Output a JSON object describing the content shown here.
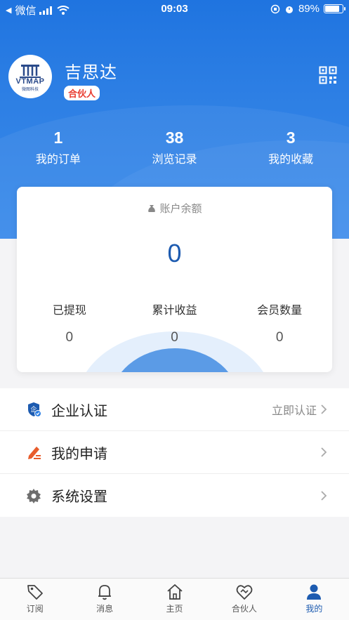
{
  "status_bar": {
    "back_app": "微信",
    "time": "09:03",
    "battery_percent": "89%",
    "battery_level": 0.89
  },
  "profile": {
    "avatar_logo": "VTMAP",
    "avatar_logo_sub": "微图科技",
    "username": "吉思达",
    "role_badge": "合伙人"
  },
  "stats": [
    {
      "value": "1",
      "label": "我的订单"
    },
    {
      "value": "38",
      "label": "浏览记录"
    },
    {
      "value": "3",
      "label": "我的收藏"
    }
  ],
  "account_card": {
    "title": "账户余额",
    "balance": "0",
    "items": [
      {
        "label": "已提现",
        "value": "0"
      },
      {
        "label": "累计收益",
        "value": "0"
      },
      {
        "label": "会员数量",
        "value": "0"
      }
    ]
  },
  "menu": [
    {
      "label": "企业认证",
      "right_text": "立即认证",
      "icon": "enterprise-shield-icon"
    },
    {
      "label": "我的申请",
      "right_text": "",
      "icon": "pen-edit-icon"
    },
    {
      "label": "系统设置",
      "right_text": "",
      "icon": "gear-icon"
    }
  ],
  "tabbar": [
    {
      "label": "订阅",
      "icon": "tag-icon"
    },
    {
      "label": "消息",
      "icon": "bell-icon"
    },
    {
      "label": "主页",
      "icon": "home-icon"
    },
    {
      "label": "合伙人",
      "icon": "handshake-heart-icon"
    },
    {
      "label": "我的",
      "icon": "person-icon",
      "active": true
    }
  ],
  "colors": {
    "primary": "#1f74e0",
    "accent_dark": "#1d5bb0",
    "badge_red": "#e8382c",
    "pen_orange": "#e85c2c"
  }
}
